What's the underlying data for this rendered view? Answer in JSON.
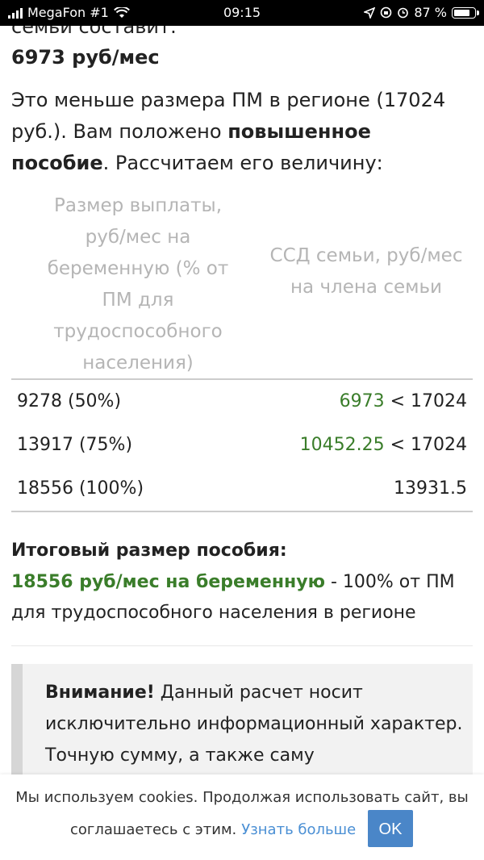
{
  "status_bar": {
    "carrier": "MegaFon #1",
    "time": "09:15",
    "battery": "87 %",
    "battery_level": 0.87,
    "icons": [
      "signal-icon",
      "wifi-icon",
      "location-icon",
      "rotation-lock-icon",
      "alarm-icon",
      "battery-icon"
    ]
  },
  "content": {
    "clipped_line": "семьи составит:",
    "income_value": "6973 руб/мес",
    "paragraph": {
      "text_a": "Это меньше размера ПМ в регионе (17024 руб.). Вам положено ",
      "bold": "повышенное пособие",
      "text_b": ". Рассчитаем его величину:"
    }
  },
  "table": {
    "header_left": "Размер выплаты, руб/мес на беременную (% от ПМ для трудоспособного населения)",
    "header_right": "ССД семьи, руб/мес на члена семьи",
    "rows": [
      {
        "payment": "9278 (50%)",
        "income": "6973",
        "comparison": " < 17024"
      },
      {
        "payment": "13917 (75%)",
        "income": "10452.25",
        "comparison": " < 17024"
      },
      {
        "payment": "18556 (100%)",
        "income": "",
        "comparison": "13931.5"
      }
    ]
  },
  "total": {
    "title": "Итоговый размер пособия:",
    "amount": "18556 руб/мес на беременную",
    "tail": " - 100% от ПМ для трудоспособного населения в регионе"
  },
  "notice": {
    "bold": "Внимание!",
    "text": " Данный расчет носит исключительно информационный характер. Точную сумму, а также саму"
  },
  "cookie": {
    "line1": "Мы используем cookies. Продолжая использовать сайт, вы",
    "line2": "соглашаетесь с этим.",
    "link": "Узнать больше",
    "ok": "OK"
  },
  "colors": {
    "accent_green": "#3a7d2a",
    "link_blue": "#4a8fd4",
    "button_blue": "#4a86c8"
  }
}
